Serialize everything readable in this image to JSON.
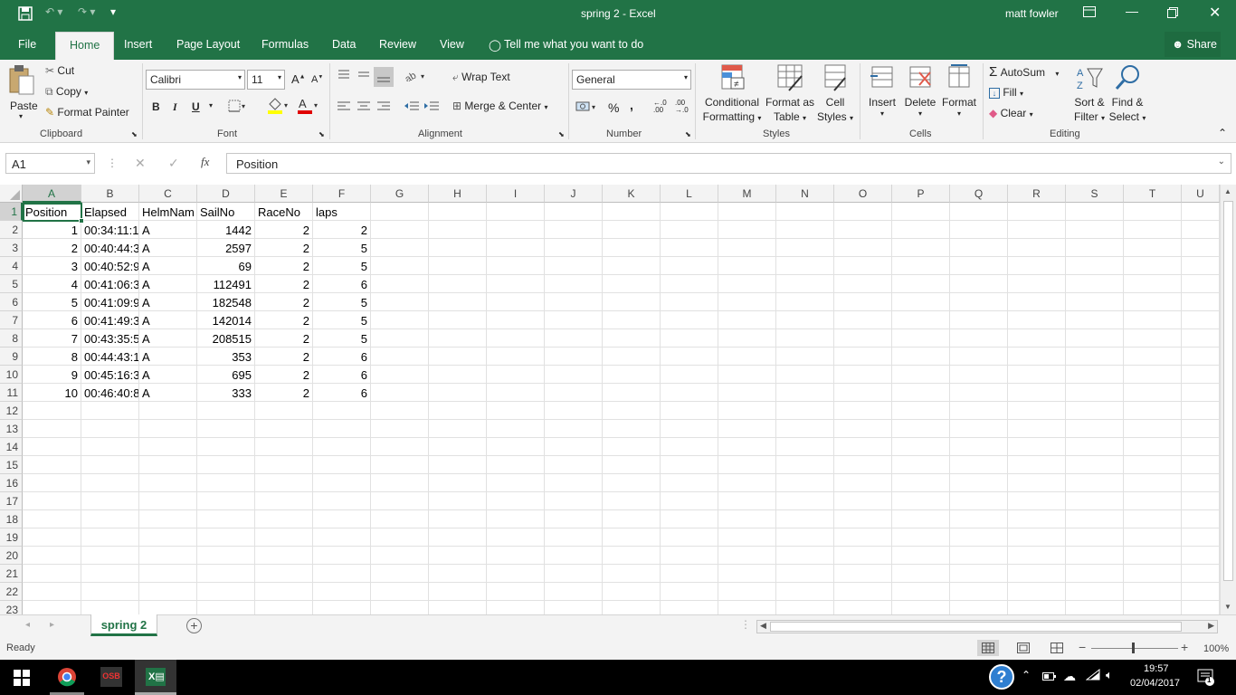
{
  "titlebar": {
    "doc_title": "spring 2 - Excel",
    "user": "matt fowler"
  },
  "menu": {
    "file": "File",
    "home": "Home",
    "insert": "Insert",
    "page_layout": "Page Layout",
    "formulas": "Formulas",
    "data": "Data",
    "review": "Review",
    "view": "View",
    "tell_me": "Tell me what you want to do",
    "share": "Share"
  },
  "ribbon": {
    "clipboard": {
      "paste": "Paste",
      "cut": "Cut",
      "copy": "Copy",
      "format_painter": "Format Painter",
      "label": "Clipboard"
    },
    "font": {
      "name": "Calibri",
      "size": "11",
      "bold": "B",
      "italic": "I",
      "underline": "U",
      "label": "Font"
    },
    "alignment": {
      "wrap_text": "Wrap Text",
      "merge_center": "Merge & Center",
      "label": "Alignment"
    },
    "number": {
      "format": "General",
      "percent": "%",
      "comma": ",",
      "label": "Number"
    },
    "styles": {
      "conditional": "Conditional",
      "formatting": "Formatting",
      "format_as": "Format as",
      "table": "Table",
      "cell": "Cell",
      "styles_word": "Styles",
      "label": "Styles"
    },
    "cells": {
      "insert": "Insert",
      "delete": "Delete",
      "format": "Format",
      "label": "Cells"
    },
    "editing": {
      "autosum": "AutoSum",
      "fill": "Fill",
      "clear": "Clear",
      "sort": "Sort &",
      "filter": "Filter",
      "find": "Find &",
      "select": "Select",
      "label": "Editing"
    }
  },
  "formula_bar": {
    "name_box": "A1",
    "fx": "fx",
    "content": "Position"
  },
  "columns": [
    "A",
    "B",
    "C",
    "D",
    "E",
    "F",
    "G",
    "H",
    "I",
    "J",
    "K",
    "L",
    "M",
    "N",
    "O",
    "P",
    "Q",
    "R",
    "S",
    "T",
    "U"
  ],
  "rows": [
    [
      "Position",
      "Elapsed",
      "HelmNam",
      "SailNo",
      "RaceNo",
      "laps"
    ],
    [
      "1",
      "00:34:11:1",
      "A",
      "1442",
      "2",
      "2"
    ],
    [
      "2",
      "00:40:44:3",
      "A",
      "2597",
      "2",
      "5"
    ],
    [
      "3",
      "00:40:52:9",
      "A",
      "69",
      "2",
      "5"
    ],
    [
      "4",
      "00:41:06:3",
      "A",
      "112491",
      "2",
      "6"
    ],
    [
      "5",
      "00:41:09:9",
      "A",
      "182548",
      "2",
      "5"
    ],
    [
      "6",
      "00:41:49:3",
      "A",
      "142014",
      "2",
      "5"
    ],
    [
      "7",
      "00:43:35:5",
      "A",
      "208515",
      "2",
      "5"
    ],
    [
      "8",
      "00:44:43:1",
      "A",
      "353",
      "2",
      "6"
    ],
    [
      "9",
      "00:45:16:3",
      "A",
      "695",
      "2",
      "6"
    ],
    [
      "10",
      "00:46:40:8",
      "A",
      "333",
      "2",
      "6"
    ]
  ],
  "row_numbers": [
    "1",
    "2",
    "3",
    "4",
    "5",
    "6",
    "7",
    "8",
    "9",
    "10",
    "11",
    "12",
    "13",
    "14",
    "15",
    "16",
    "17",
    "18",
    "19",
    "20",
    "21",
    "22",
    "23"
  ],
  "sheet_tab": "spring 2",
  "status": {
    "ready": "Ready",
    "zoom": "100%"
  },
  "taskbar": {
    "time": "19:57",
    "date": "02/04/2017",
    "osb": "OSB",
    "notif_count": "1"
  },
  "colors": {
    "excel_green": "#217346",
    "grid_line": "#e1e1e1",
    "header_bg": "#f3f3f3"
  }
}
